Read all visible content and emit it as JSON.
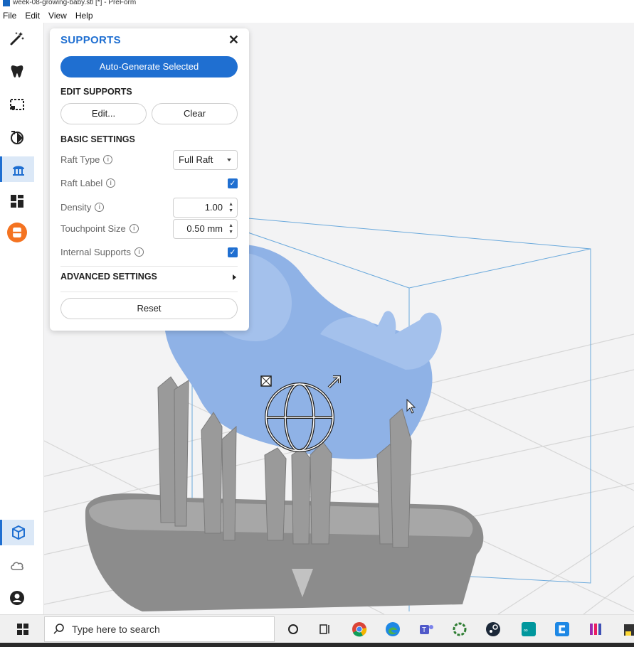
{
  "window": {
    "title": "week-08-growing-baby.stl [*] - PreForm"
  },
  "menu": [
    "File",
    "Edit",
    "View",
    "Help"
  ],
  "toolbar": {
    "top_tools": [
      "magic-wand-icon",
      "tooth-icon",
      "select-region-icon",
      "orientation-icon",
      "supports-icon",
      "layout-icon",
      "printer-icon"
    ],
    "bottom_tools": [
      "local-view-icon",
      "cloud-icon",
      "account-icon"
    ]
  },
  "panel": {
    "title": "SUPPORTS",
    "close": "✕",
    "auto_generate": "Auto-Generate Selected",
    "edit_supports": {
      "heading": "EDIT SUPPORTS",
      "edit": "Edit...",
      "clear": "Clear"
    },
    "basic": {
      "heading": "BASIC SETTINGS",
      "raft_type_label": "Raft Type",
      "raft_type_value": "Full Raft",
      "raft_label_label": "Raft Label",
      "raft_label_checked": true,
      "density_label": "Density",
      "density_value": "1.00",
      "touchpoint_label": "Touchpoint Size",
      "touchpoint_value": "0.50 mm",
      "internal_label": "Internal Supports",
      "internal_checked": true
    },
    "advanced_heading": "ADVANCED SETTINGS",
    "reset": "Reset",
    "info_glyph": "i",
    "check_glyph": "✓"
  },
  "taskbar": {
    "search_placeholder": "Type here to search",
    "apps": [
      "cortana-icon",
      "task-view-icon",
      "chrome-icon",
      "edge-icon",
      "teams-icon",
      "app-icon",
      "steam-icon",
      "arduino-icon",
      "app-icon",
      "app-icon"
    ]
  },
  "colors": {
    "accent": "#1f6fd1",
    "model": "#8fb2e6",
    "supports": "#9a9a9a",
    "orange": "#f47321"
  }
}
